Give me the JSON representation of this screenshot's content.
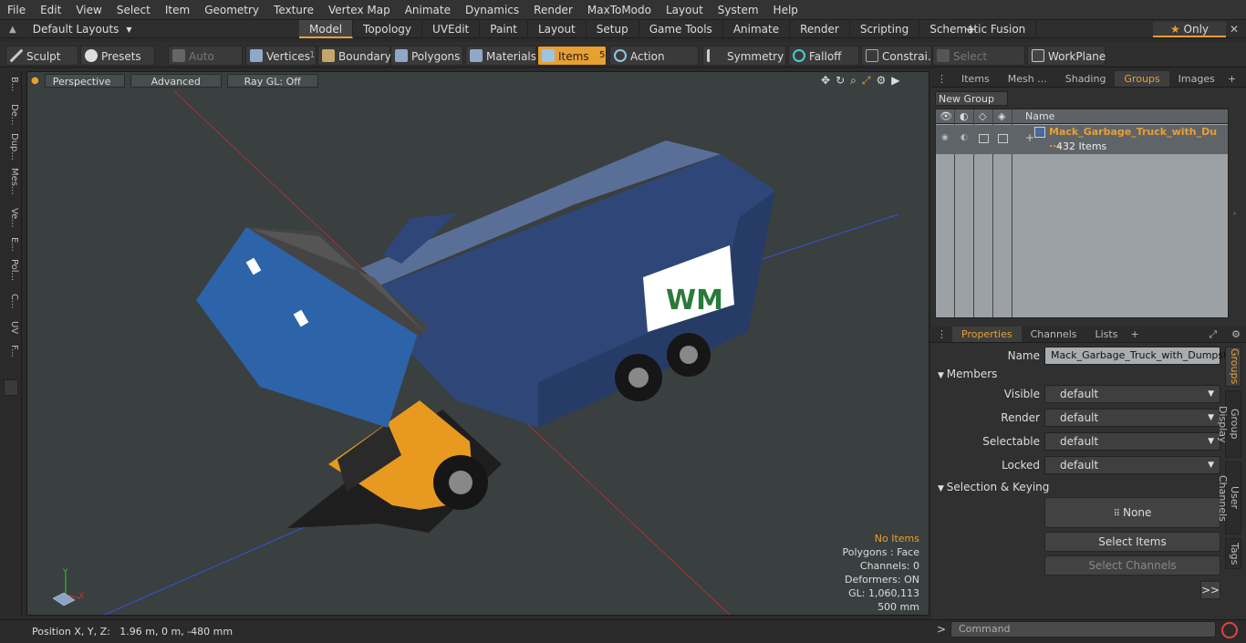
{
  "menu": [
    "File",
    "Edit",
    "View",
    "Select",
    "Item",
    "Geometry",
    "Texture",
    "Vertex Map",
    "Animate",
    "Dynamics",
    "Render",
    "MaxToModo",
    "Layout",
    "System",
    "Help"
  ],
  "layout_selector": "Default Layouts",
  "tabs": [
    "Model",
    "Topology",
    "UVEdit",
    "Paint",
    "Layout",
    "Setup",
    "Game Tools",
    "Animate",
    "Render",
    "Scripting",
    "Schematic Fusion"
  ],
  "active_tab": "Model",
  "only_label": "Only",
  "toolbar": {
    "sculpt": "Sculpt",
    "presets": "Presets",
    "auto_select": "Auto Select",
    "vertices": "Vertices",
    "vertices_count": "1",
    "boundary": "Boundary",
    "polygons": "Polygons",
    "materials": "Materials",
    "items": "Items",
    "items_count": "5",
    "action_center": "Action Center",
    "symmetry": "Symmetry",
    "falloff": "Falloff",
    "constrain": "Constrai...",
    "select_through": "Select Through",
    "workplane": "WorkPlane"
  },
  "left_strip": [
    "B...",
    "De...",
    "Dup...",
    "Mes...",
    "Ve...",
    "E...",
    "Pol...",
    "C...",
    "UV",
    "F..."
  ],
  "viewport": {
    "view": "Perspective",
    "style": "Advanced",
    "raygl": "Ray GL: Off"
  },
  "stats": {
    "selection": "No Items",
    "polygons": "Polygons : Face",
    "channels": "Channels: 0",
    "deformers": "Deformers: ON",
    "gl": "GL: 1,060,113",
    "scale": "500 mm"
  },
  "axis": {
    "y": "Y",
    "x": "X"
  },
  "status": "Position X, Y, Z:   1.96 m, 0 m, -480 mm",
  "right_tabs": [
    "Items",
    "Mesh ...",
    "Shading",
    "Groups",
    "Images"
  ],
  "active_right_tab": "Groups",
  "new_group": "New Group",
  "group_header": "Name",
  "group": {
    "name": "Mack_Garbage_Truck_with_Du ...",
    "count": "432 Items"
  },
  "props_tabs": [
    "Properties",
    "Channels",
    "Lists"
  ],
  "props": {
    "name_label": "Name",
    "name_value": "Mack_Garbage_Truck_with_Dumpster",
    "members": "Members",
    "visible": "Visible",
    "render": "Render",
    "selectable": "Selectable",
    "locked": "Locked",
    "default": "default",
    "sel_keying": "Selection & Keying",
    "none": "None",
    "select_items": "Select Items",
    "select_channels": "Select Channels",
    "more": ">>"
  },
  "vertical_tabs": [
    "Groups",
    "Group Display",
    "User Channels",
    "Tags"
  ],
  "command_placeholder": "Command",
  "colors": {
    "accent": "#e8a033",
    "truck_blue": "#2e4778",
    "cab_orange": "#e79a1f"
  }
}
